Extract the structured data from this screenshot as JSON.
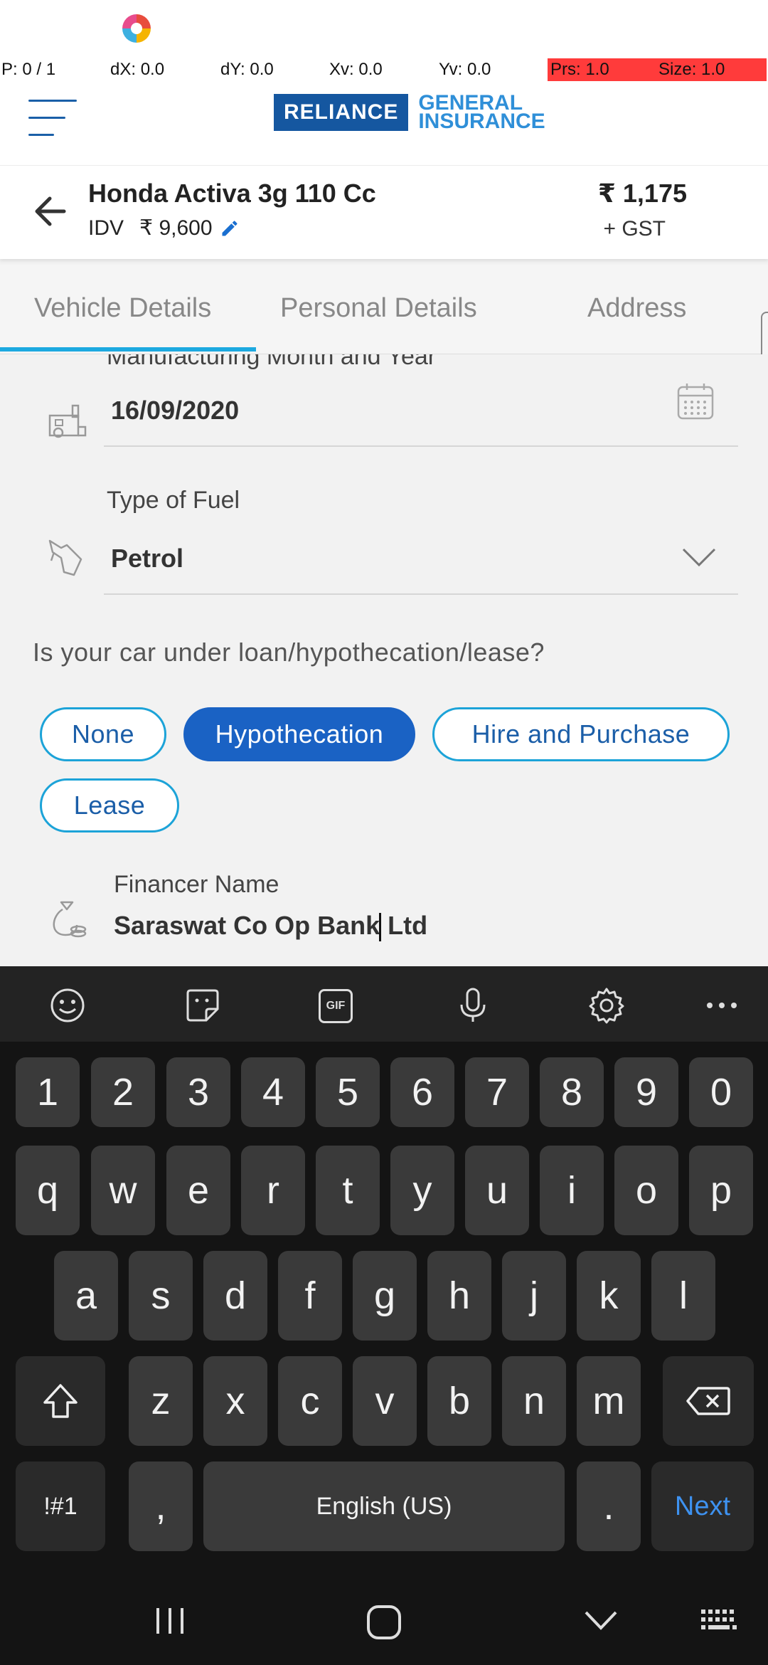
{
  "debug": {
    "pointer": "P: 0 / 1",
    "dx": "dX: 0.0",
    "dy": "dY: 0.0",
    "xv": "Xv: 0.0",
    "yv": "Yv: 0.0",
    "prs": "Prs: 1.0",
    "size": "Size: 1.0"
  },
  "header": {
    "logo_primary": "RELIANCE",
    "logo_secondary_line1": "GENERAL",
    "logo_secondary_line2": "INSURANCE"
  },
  "vehicle": {
    "name": "Honda Activa 3g 110 Cc",
    "idv_label": "IDV",
    "idv_value": "₹ 9,600",
    "price": "₹ 1,175",
    "price_suffix": "+ GST"
  },
  "tabs": [
    {
      "label": "Vehicle Details",
      "active": true
    },
    {
      "label": "Personal Details",
      "active": false
    },
    {
      "label": "Address",
      "active": false
    }
  ],
  "form": {
    "mfg_label": "Manufacturing Month and Year",
    "mfg_value": "16/09/2020",
    "fuel_label": "Type of Fuel",
    "fuel_value": "Petrol",
    "loan_question": "Is your car under loan/hypothecation/lease?",
    "loan_options": [
      "None",
      "Hypothecation",
      "Hire and Purchase",
      "Lease"
    ],
    "loan_selected": "Hypothecation",
    "financer_label": "Financer Name",
    "financer_value_before_cursor": "Saraswat Co Op Bank",
    "financer_value_after_cursor": " Ltd"
  },
  "keyboard": {
    "number_row": [
      "1",
      "2",
      "3",
      "4",
      "5",
      "6",
      "7",
      "8",
      "9",
      "0"
    ],
    "row1": [
      "q",
      "w",
      "e",
      "r",
      "t",
      "y",
      "u",
      "i",
      "o",
      "p"
    ],
    "row2": [
      "a",
      "s",
      "d",
      "f",
      "g",
      "h",
      "j",
      "k",
      "l"
    ],
    "row3": [
      "z",
      "x",
      "c",
      "v",
      "b",
      "n",
      "m"
    ],
    "symbols_key": "!#1",
    "comma_key": ",",
    "space_key": "English (US)",
    "period_key": ".",
    "action_key": "Next",
    "toolbar_gif": "GIF"
  },
  "colors": {
    "accent": "#1a62c4",
    "tab_underline": "#1da9e0",
    "next_key": "#3e92f0"
  }
}
